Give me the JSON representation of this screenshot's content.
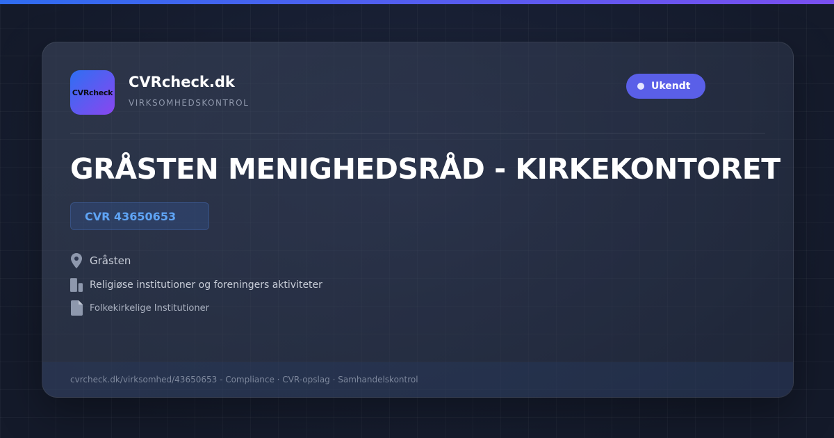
{
  "brand": {
    "logo_text": "CVRcheck",
    "name": "CVRcheck.dk",
    "tagline": "VIRKSOMHEDSKONTROL"
  },
  "status": {
    "label": "Ukendt",
    "color": "#5a5fe8"
  },
  "company": {
    "name": "GRÅSTEN MENIGHEDSRÅD - KIRKEKONTORET",
    "cvr": "CVR 43650653"
  },
  "details": {
    "city": "Gråsten",
    "industry": "Religiøse institutioner og foreningers aktiviteter",
    "type": "Folkekirkelige Institutioner"
  },
  "footer": {
    "text": "cvrcheck.dk/virksomhed/43650653 - Compliance · CVR-opslag · Samhandelskontrol"
  },
  "icons": {
    "location": "map-pin-icon",
    "industry": "building-icon",
    "type": "document-icon"
  },
  "colors": {
    "accent": "#5a5fe8",
    "cvr": "#5fa4f5",
    "background": "#151c2e"
  }
}
